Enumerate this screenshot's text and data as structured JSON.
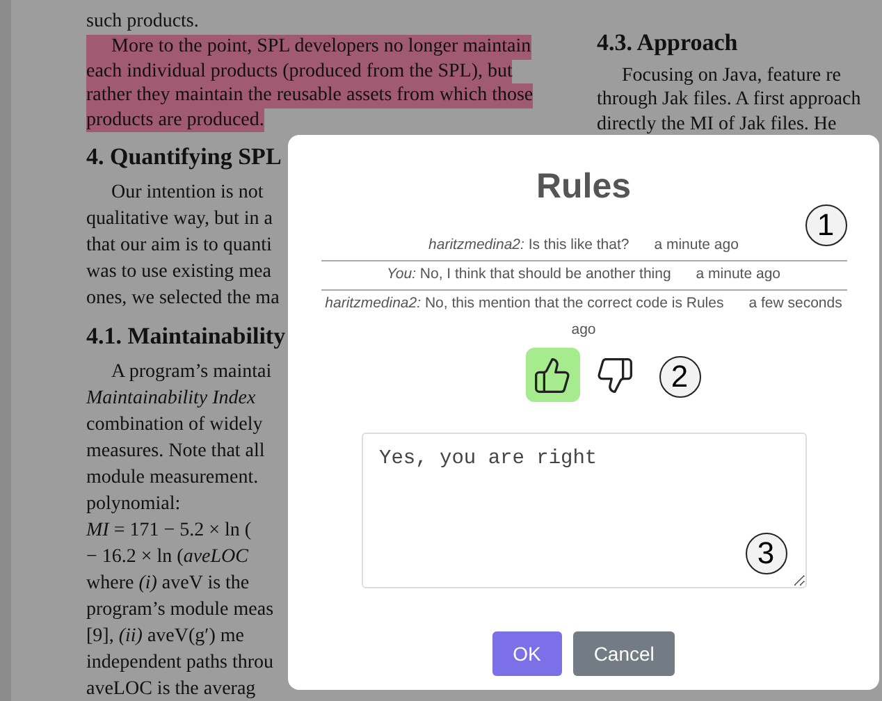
{
  "document": {
    "left_column": [
      {
        "kind": "paragraph",
        "highlighted": false,
        "indent": false,
        "lines": [
          "such products."
        ]
      },
      {
        "kind": "paragraph",
        "highlighted": true,
        "indent": true,
        "lines": [
          "More to the point, SPL developers no longer maintain",
          "each individual products (produced from the SPL), but",
          "rather they maintain the reusable assets from which those",
          "products are produced."
        ]
      },
      {
        "kind": "heading",
        "text": "4. Quantifying SPL"
      },
      {
        "kind": "paragraph",
        "highlighted": false,
        "indent": true,
        "lines": [
          "Our intention is not",
          "qualitative way, but in a",
          "that our aim is to quanti",
          "was to use existing mea",
          "ones, we selected the ma"
        ]
      },
      {
        "kind": "heading",
        "text": "4.1. Maintainability"
      },
      {
        "kind": "paragraph",
        "highlighted": false,
        "indent": true,
        "lines": [
          "A program’s maintai",
          "*Maintainability  Index*",
          "combination of widely",
          "measures. Note that all",
          "module measurement.",
          "polynomial:"
        ]
      },
      {
        "kind": "paragraph",
        "highlighted": false,
        "indent": false,
        "lines": [
          "*MI*  = 171  − 5.2 × ln (",
          "− 16.2 × ln (*aveLOC*",
          "where *(i)* aveV is the",
          "program’s module meas",
          "[9], *(ii)* aveV(g′) me",
          "independent paths throu",
          "aveLOC is the averag"
        ]
      }
    ],
    "right_column": [
      {
        "kind": "heading",
        "text": "4.3. Approach"
      },
      {
        "kind": "paragraph",
        "highlighted": false,
        "indent": true,
        "lines": [
          "Focusing on Java, feature re",
          "through Jak files. A first approach",
          "directly the MI of Jak files. He"
        ]
      }
    ]
  },
  "dialog": {
    "title": "Rules",
    "messages": [
      {
        "author": "haritzmedina2:",
        "text": "Is this like that?",
        "time": "a minute ago"
      },
      {
        "author": "You:",
        "text": "No, I think that should be another thing",
        "time": "a minute ago"
      },
      {
        "author": "haritzmedina2:",
        "text": "No, this mention that the correct code is Rules",
        "time": "a few seconds ago"
      }
    ],
    "messages_marker": "1",
    "rating": [
      {
        "kind": "up",
        "selected": true
      },
      {
        "kind": "down",
        "selected": false
      }
    ],
    "rating_marker": "2",
    "reply": {
      "value": "Yes, you are right",
      "marker": "3"
    },
    "buttons": [
      {
        "label": "OK",
        "kind": "primary"
      },
      {
        "label": "Cancel",
        "kind": "secondary"
      }
    ]
  }
}
